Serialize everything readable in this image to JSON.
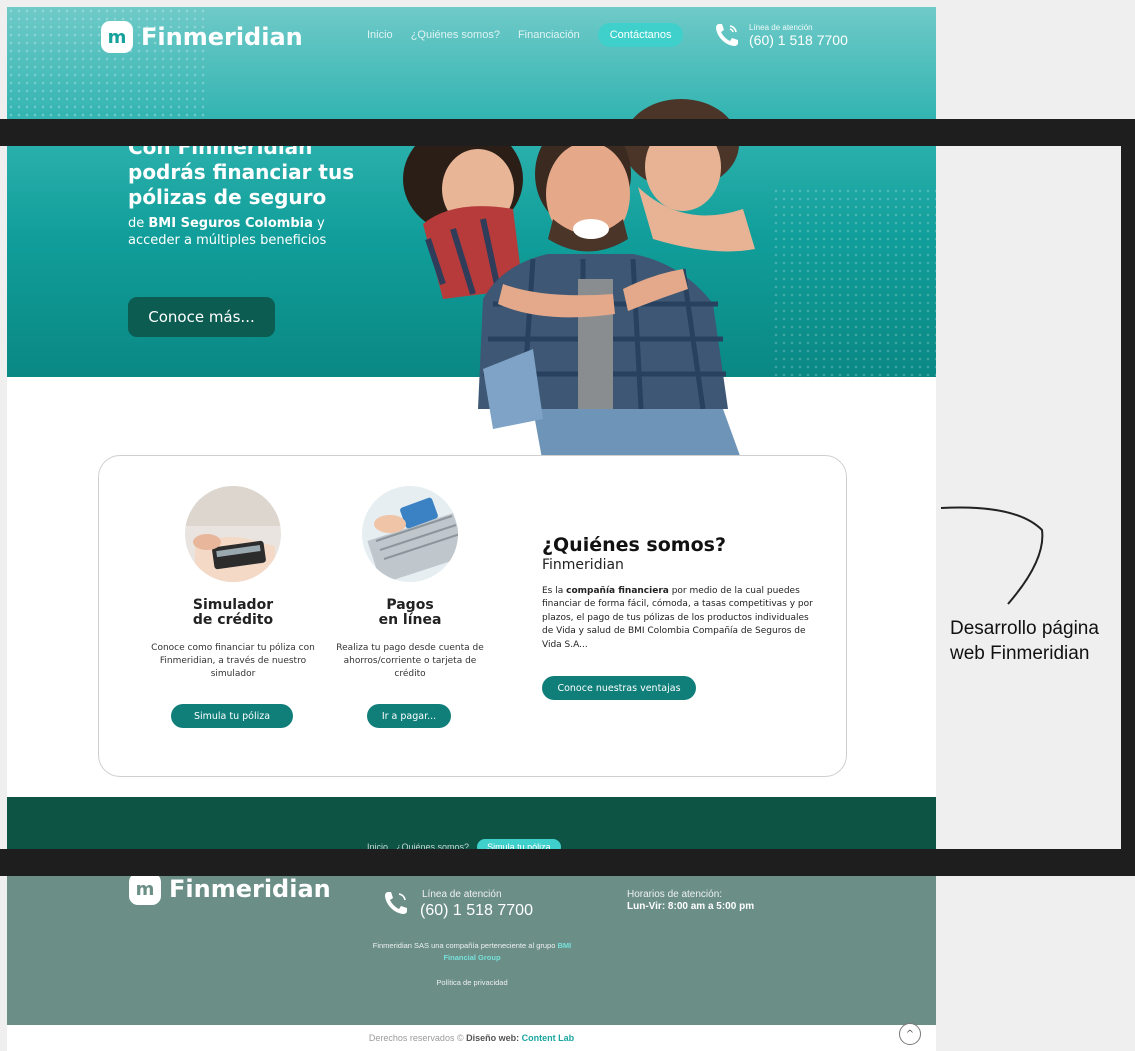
{
  "header": {
    "brand": "Finmeridian",
    "logo_glyph": "m",
    "nav": [
      "Inicio",
      "¿Quiénes somos?",
      "Financiación"
    ],
    "contact_label": "Contáctanos",
    "phone_label": "Línea de atención",
    "phone_number": "(60) 1 518 7700"
  },
  "hero": {
    "title": "Con Finmeridian podrás financiar tus pólizas de seguro",
    "subtitle_prefix": "de ",
    "subtitle_bold": "BMI Seguros Colombia",
    "subtitle_suffix": " y acceder a múltiples beneficios",
    "button": "Conoce más..."
  },
  "features": [
    {
      "title_line1": "Simulador",
      "title_line2": "de crédito",
      "description": "Conoce como financiar tu póliza con Finmeridian, a través de nuestro simulador",
      "button": "Simula tu póliza"
    },
    {
      "title_line1": "Pagos",
      "title_line2": "en línea",
      "description": "Realiza tu pago desde cuenta de ahorros/corriente o tarjeta de crédito",
      "button": "Ir a pagar..."
    }
  ],
  "about": {
    "title": "¿Quiénes somos?",
    "subtitle": "Finmeridian",
    "text_prefix": "Es la ",
    "text_bold": "compañía financiera",
    "text_suffix": " por medio de la cual puedes financiar de forma fácil, cómoda, a tasas competitivas y por plazos, el pago de tus pólizas de los productos individuales de Vida y salud de BMI Colombia Compañía de Seguros de Vida S.A...",
    "button": "Conoce nuestras ventajas"
  },
  "footer": {
    "nav": [
      "Inicio",
      "¿Quiénes somos?"
    ],
    "cta": "Simula tu póliza",
    "brand": "Finmeridian",
    "phone_label": "Línea de atención",
    "phone_number": "(60) 1 518 7700",
    "hours_label": "Horarios de atención:",
    "hours_value": "Lun-Vir: 8:00 am a 5:00 pm",
    "company_text": "Finmeridian SAS una compañía perteneciente al grupo",
    "company_group": "BMI Financial Group",
    "privacy": "Política de privacidad",
    "copyright_prefix": "Derechos reservados © ",
    "copyright_bold": "Diseño web: ",
    "copyright_lab": "Content Lab"
  },
  "caption": "Desarrollo página web Finmeridian",
  "colors": {
    "teal_primary": "#107f7a",
    "teal_light": "#3fd0cc",
    "dark_green": "#0d5445",
    "footer_grey_green": "#6b8f87",
    "frame_black": "#1e1e1e"
  }
}
